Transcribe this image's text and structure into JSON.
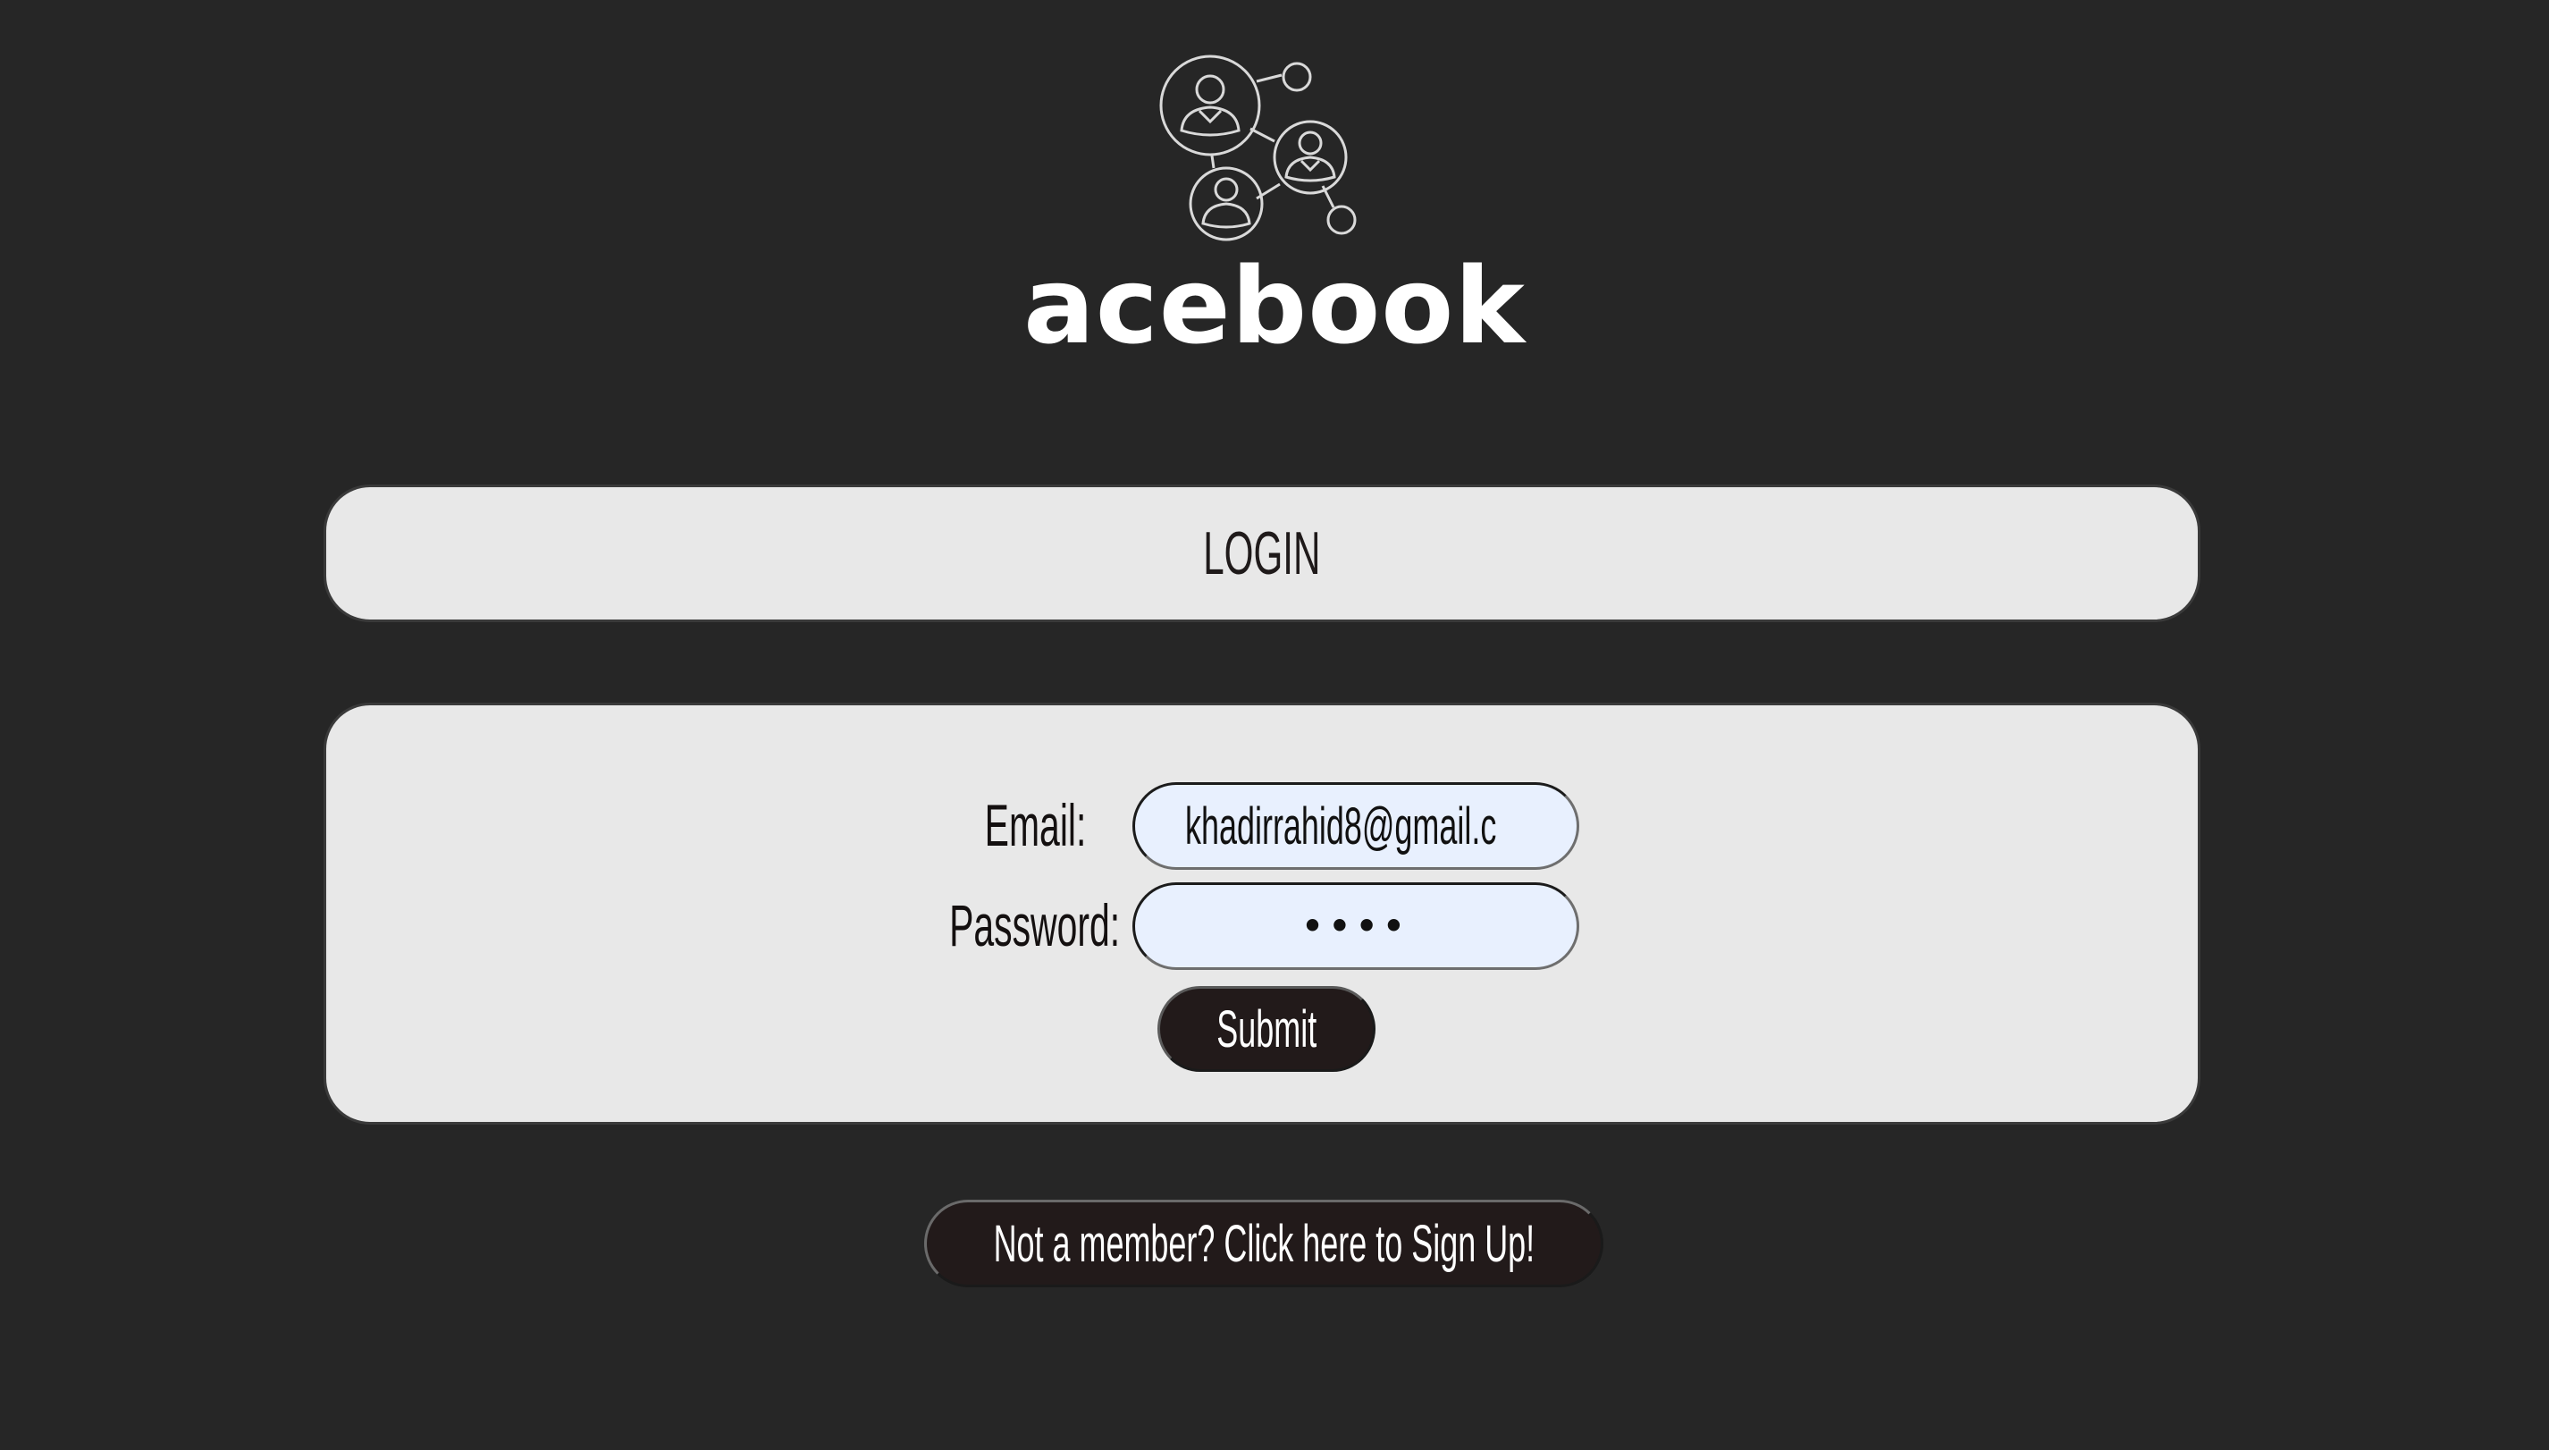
{
  "brand": {
    "name": "acebook",
    "logo_icon": "social-network-people-icon"
  },
  "login_banner": {
    "title": "LOGIN"
  },
  "form": {
    "email_label": "Email:",
    "email_value": "khadirrahid8@gmail.c",
    "password_label": "Password:",
    "password_value": "••••",
    "submit_label": "Submit"
  },
  "signup": {
    "label": "Not a member? Click here to Sign Up!"
  },
  "colors": {
    "background": "#262626",
    "card": "#e8e8e8",
    "input": "#e8f0fe",
    "button": "#221a1a",
    "text_dark": "#1f1a1a",
    "text_light": "#ffffff"
  }
}
